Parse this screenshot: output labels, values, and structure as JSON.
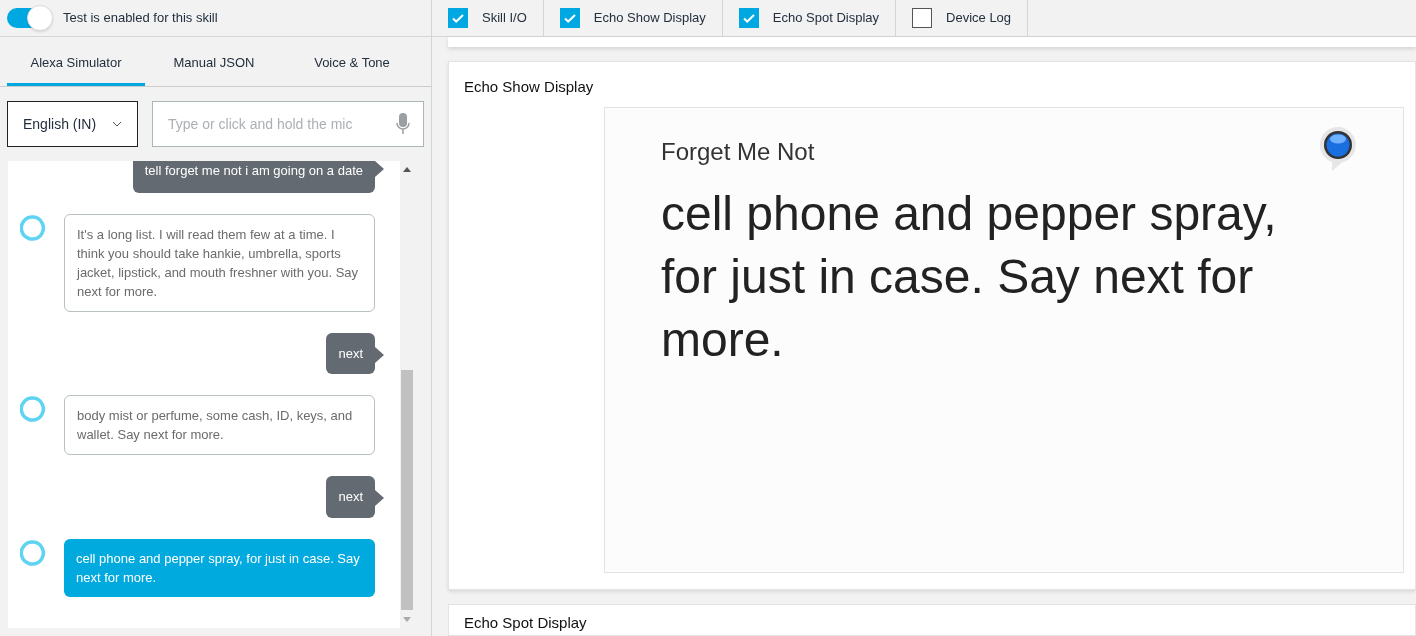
{
  "test_toggle": {
    "label": "Test is enabled for this skill",
    "on": true
  },
  "view_options": [
    {
      "label": "Skill I/O",
      "checked": true
    },
    {
      "label": "Echo Show Display",
      "checked": true
    },
    {
      "label": "Echo Spot Display",
      "checked": true
    },
    {
      "label": "Device Log",
      "checked": false
    }
  ],
  "tabs": [
    {
      "label": "Alexa Simulator",
      "selected": true
    },
    {
      "label": "Manual JSON",
      "selected": false
    },
    {
      "label": "Voice & Tone",
      "selected": false
    }
  ],
  "language": {
    "value": "English (IN)"
  },
  "utterance": {
    "placeholder": "Type or click and hold the mic"
  },
  "messages": [
    {
      "kind": "user",
      "text": "tell forget me not i am going on a date"
    },
    {
      "kind": "alexa",
      "active": false,
      "text": "It's a long list. I will read them few at a time. I think you should take hankie, umbrella, sports jacket, lipstick, and mouth freshner with you. Say next for more."
    },
    {
      "kind": "user",
      "text": "next"
    },
    {
      "kind": "alexa",
      "active": false,
      "text": "body mist or perfume, some cash, ID, keys, and wallet. Say next for more."
    },
    {
      "kind": "user",
      "text": "next"
    },
    {
      "kind": "alexa",
      "active": true,
      "text": "cell phone and pepper spray, for just in case. Say next for more."
    }
  ],
  "echo_show": {
    "title": "Echo Show Display",
    "skill_name": "Forget Me Not",
    "body": "cell phone and pepper spray, for just in case. Say next for more."
  },
  "echo_spot": {
    "title": "Echo Spot Display"
  }
}
